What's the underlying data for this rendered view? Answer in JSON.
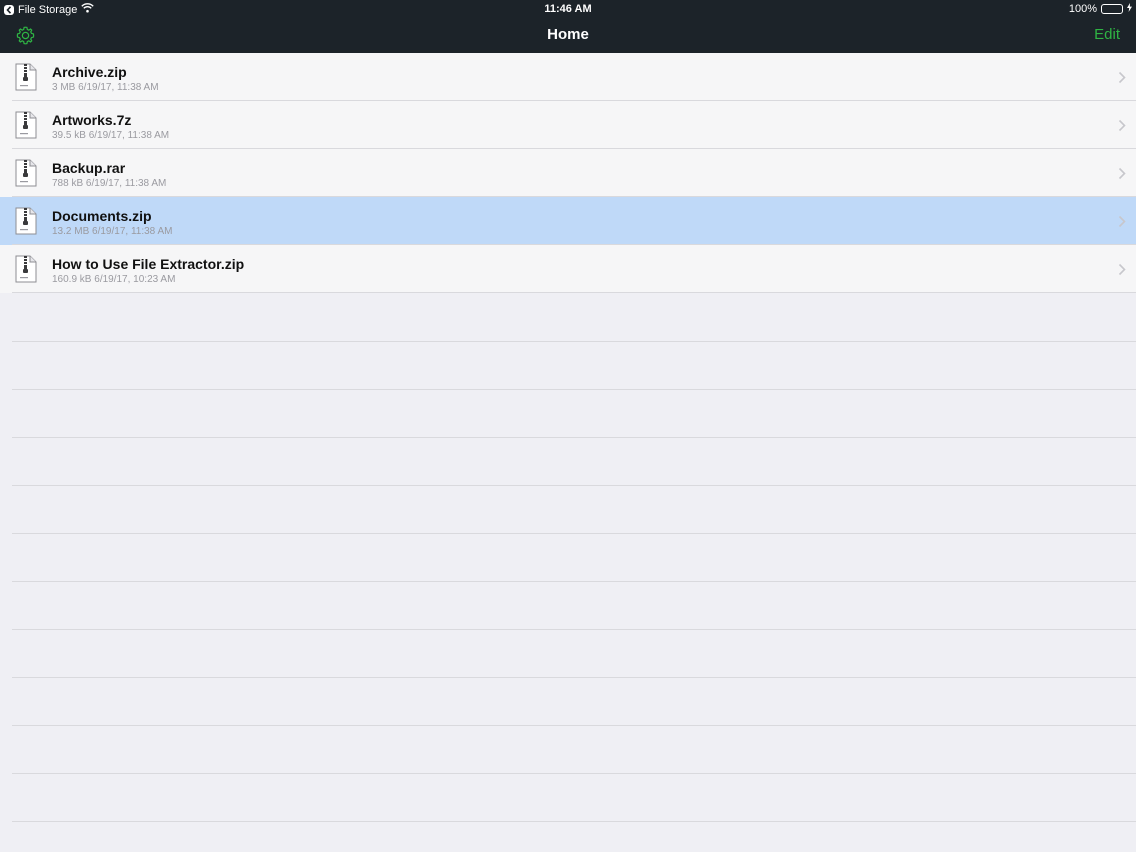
{
  "status_bar": {
    "back_app": "File Storage",
    "time": "11:46 AM",
    "battery": "100%",
    "battery_level": 1.0
  },
  "nav": {
    "title": "Home",
    "edit_label": "Edit",
    "settings_icon": "gear-icon"
  },
  "colors": {
    "accent": "#2fb344",
    "header_bg": "#1c2329",
    "selected_row": "#bfd9f8"
  },
  "files": [
    {
      "name": "Archive.zip",
      "meta": "3 MB 6/19/17, 11:38 AM",
      "icon": "zip-file-icon",
      "selected": false
    },
    {
      "name": "Artworks.7z",
      "meta": "39.5 kB 6/19/17, 11:38 AM",
      "icon": "7z-file-icon",
      "selected": false
    },
    {
      "name": "Backup.rar",
      "meta": "788 kB 6/19/17, 11:38 AM",
      "icon": "rar-file-icon",
      "selected": false
    },
    {
      "name": "Documents.zip",
      "meta": "13.2 MB 6/19/17, 11:38 AM",
      "icon": "zip-file-icon",
      "selected": true
    },
    {
      "name": "How to Use File Extractor.zip",
      "meta": "160.9 kB 6/19/17, 10:23 AM",
      "icon": "zip-file-icon",
      "selected": false
    }
  ]
}
